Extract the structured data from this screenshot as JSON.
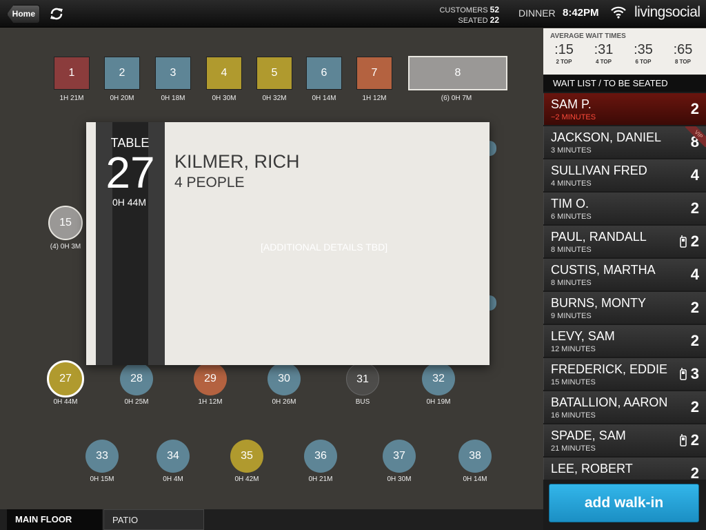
{
  "topbar": {
    "home_label": "Home",
    "customers_label": "CUSTOMERS",
    "customers_count": "52",
    "seated_label": "SEATED",
    "seated_count": "22",
    "meal_period": "DINNER",
    "clock": "8:42PM",
    "brand": "livingsocial",
    "icons": [
      "refresh-icon",
      "wifi-icon"
    ]
  },
  "floor": {
    "square_tables": [
      {
        "number": "1",
        "time": "1H 21M",
        "color": "#8b3c3c"
      },
      {
        "number": "2",
        "time": "0H 20M",
        "color": "#5e8596"
      },
      {
        "number": "3",
        "time": "0H 18M",
        "color": "#5e8596"
      },
      {
        "number": "4",
        "time": "0H 30M",
        "color": "#b09a2e"
      },
      {
        "number": "5",
        "time": "0H 32M",
        "color": "#b09a2e"
      },
      {
        "number": "6",
        "time": "0H 14M",
        "color": "#5e8596"
      },
      {
        "number": "7",
        "time": "1H 12M",
        "color": "#b46240"
      }
    ],
    "table_8": {
      "number": "8",
      "time": "(6) 0H 7M"
    },
    "table_15": {
      "number": "15",
      "time": "(4) 0H 3M"
    },
    "round_row_1": [
      {
        "number": "27",
        "time": "0H 44M",
        "color": "#b09a2e"
      },
      {
        "number": "28",
        "time": "0H 25M",
        "color": "#5e8596"
      },
      {
        "number": "29",
        "time": "1H 12M",
        "color": "#b46240"
      },
      {
        "number": "30",
        "time": "0H 26M",
        "color": "#5e8596"
      },
      {
        "number": "31",
        "time": "BUS",
        "color": "#4d4c4a"
      },
      {
        "number": "32",
        "time": "0H 19M",
        "color": "#5e8596"
      }
    ],
    "round_row_2": [
      {
        "number": "33",
        "time": "0H 15M",
        "color": "#5e8596"
      },
      {
        "number": "34",
        "time": "0H 4M",
        "color": "#5e8596"
      },
      {
        "number": "35",
        "time": "0H 42M",
        "color": "#b09a2e"
      },
      {
        "number": "36",
        "time": "0H 21M",
        "color": "#5e8596"
      },
      {
        "number": "37",
        "time": "0H 30M",
        "color": "#5e8596"
      },
      {
        "number": "38",
        "time": "0H 14M",
        "color": "#5e8596"
      }
    ]
  },
  "card": {
    "table_label": "TABLE",
    "table_number": "27",
    "table_time": "0H 44M",
    "guest_name": "KILMER, RICH",
    "party": "4 PEOPLE",
    "details": "[ADDITIONAL DETAILS TBD]"
  },
  "tabs": {
    "main": "MAIN FLOOR",
    "patio": "PATIO"
  },
  "panel": {
    "wait_title": "AVERAGE WAIT TIMES",
    "wait_times": [
      {
        "value": ":15",
        "label": "2 TOP"
      },
      {
        "value": ":31",
        "label": "4 TOP"
      },
      {
        "value": ":35",
        "label": "6 TOP"
      },
      {
        "value": ":65",
        "label": "8 TOP"
      }
    ],
    "list_header": "WAIT LIST / TO BE SEATED",
    "wait_list": [
      {
        "name": "SAM P.",
        "time": "−2 MINUTES",
        "size": "2",
        "urgent": true
      },
      {
        "name": "JACKSON, DANIEL",
        "time": "3 MINUTES",
        "size": "8",
        "vip": "VIP"
      },
      {
        "name": "SULLIVAN FRED",
        "time": "4 MINUTES",
        "size": "4"
      },
      {
        "name": "TIM O.",
        "time": "6 MINUTES",
        "size": "2"
      },
      {
        "name": "PAUL, RANDALL",
        "time": "8  MINUTES",
        "size": "2",
        "phone": true
      },
      {
        "name": "CUSTIS, MARTHA",
        "time": "8 MINUTES",
        "size": "4"
      },
      {
        "name": "BURNS, MONTY",
        "time": "9 MINUTES",
        "size": "2"
      },
      {
        "name": "LEVY, SAM",
        "time": "12 MINUTES",
        "size": "2"
      },
      {
        "name": "FREDERICK, EDDIE",
        "time": "15 MINUTES",
        "size": "3",
        "phone": true
      },
      {
        "name": "BATALLION, AARON",
        "time": "16 MINUTES",
        "size": "2"
      },
      {
        "name": "SPADE, SAM",
        "time": "21 MINUTES",
        "size": "2",
        "phone": true
      },
      {
        "name": "LEE, ROBERT",
        "time": "",
        "size": "2"
      }
    ],
    "add_walkin_label": "add walk-in"
  }
}
